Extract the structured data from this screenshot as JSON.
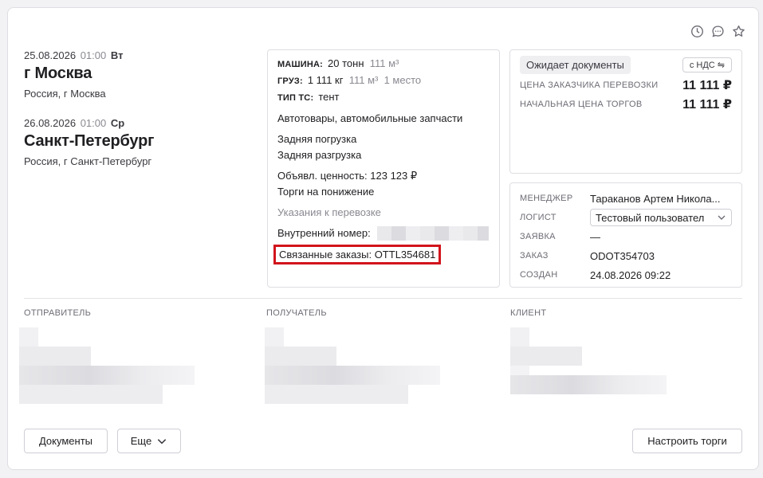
{
  "route": {
    "from": {
      "date": "25.08.2026",
      "time": "01:00",
      "dow": "Вт",
      "city": "г Москва",
      "region": "Россия, г Москва"
    },
    "to": {
      "date": "26.08.2026",
      "time": "01:00",
      "dow": "Ср",
      "city": "Санкт-Петербург",
      "region": "Россия, г Санкт-Петербург"
    }
  },
  "details": {
    "machine_label": "МАШИНА:",
    "machine_weight": "20 тонн",
    "machine_volume": "111 м³",
    "cargo_label": "ГРУЗ:",
    "cargo_weight": "1 111 кг",
    "cargo_volume": "111 м³",
    "cargo_places": "1 место",
    "vehicle_type_label": "ТИП ТС:",
    "vehicle_type": "тент",
    "cargo_name": "Автотовары, автомобильные запчасти",
    "loading": "Задняя погрузка",
    "unloading": "Задняя разгрузка",
    "declared_value": "Объявл. ценность: 123 123 ₽",
    "bidding": "Торги на понижение",
    "instructions_link": "Указания к перевозке",
    "internal_number_label": "Внутренний номер:",
    "related_orders": "Связанные заказы: OTTL354681"
  },
  "status": {
    "badge": "Ожидает документы",
    "vat_button": "с НДС ⇋",
    "prices": [
      {
        "label": "ЦЕНА ЗАКАЗЧИКА ПЕРЕВОЗКИ",
        "value": "11 111 ₽"
      },
      {
        "label": "НАЧАЛЬНАЯ ЦЕНА ТОРГОВ",
        "value": "11 111 ₽"
      }
    ]
  },
  "people": {
    "manager_label": "МЕНЕДЖЕР",
    "manager_value": "Тараканов Артем Никола...",
    "logist_label": "ЛОГИСТ",
    "logist_value": "Тестовый пользовател",
    "request_label": "ЗАЯВКА",
    "request_value": "—",
    "order_label": "ЗАКАЗ",
    "order_value": "ODOT354703",
    "created_label": "СОЗДАН",
    "created_value": "24.08.2026 09:22"
  },
  "parties": {
    "sender_label": "ОТПРАВИТЕЛЬ",
    "receiver_label": "ПОЛУЧАТЕЛЬ",
    "client_label": "КЛИЕНТ"
  },
  "actions": {
    "documents": "Документы",
    "more": "Еще",
    "setup_bidding": "Настроить торги"
  },
  "icons": [
    "clock-icon",
    "comment-icon",
    "star-icon",
    "chevron-down-icon"
  ]
}
